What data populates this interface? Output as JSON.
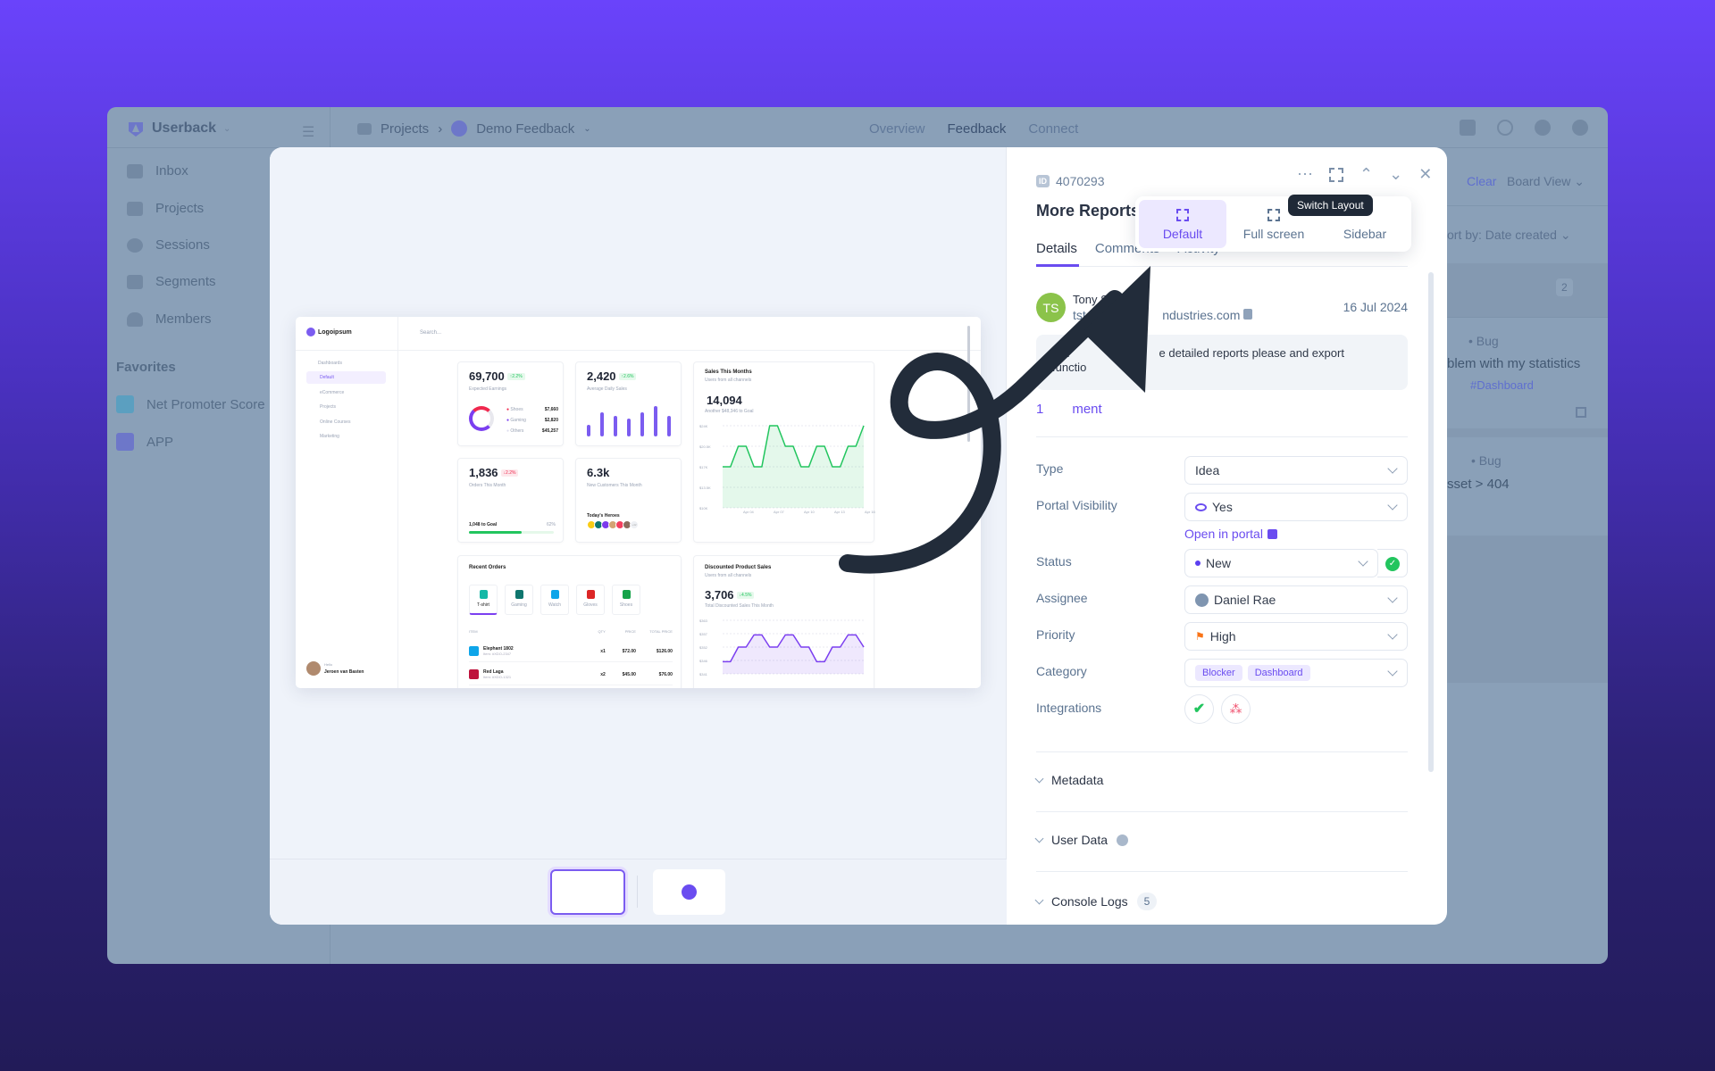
{
  "app": {
    "name": "Userback",
    "breadcrumb": [
      "Projects",
      "Demo Feedback"
    ],
    "nav": [
      "Overview",
      "Feedback",
      "Connect"
    ],
    "sidebar": {
      "items": [
        {
          "label": "Inbox",
          "icon": "inbox-icon"
        },
        {
          "label": "Projects",
          "icon": "folder-icon"
        },
        {
          "label": "Sessions",
          "icon": "play-icon"
        },
        {
          "label": "Segments",
          "icon": "layers-icon"
        },
        {
          "label": "Members",
          "icon": "user-icon"
        }
      ],
      "favorites_title": "Favorites",
      "favorites": [
        {
          "label": "Net Promoter Score",
          "icon": "pie-chart-icon"
        },
        {
          "label": "APP",
          "icon": "userback-logo-icon"
        }
      ]
    },
    "board": {
      "clear": "Clear",
      "view": "Board View",
      "sort": "ort by: Date created",
      "count": "2",
      "cards": [
        {
          "type": "Bug",
          "title": "blem with my statistics",
          "tag": "#Dashboard"
        },
        {
          "type": "Bug",
          "title": "sset > 404"
        }
      ]
    }
  },
  "feedback": {
    "id_badge": "ID",
    "id": "4070293",
    "title": "More Reports",
    "tabs": [
      "Details",
      "Comments",
      "Activity"
    ],
    "layout_menu": {
      "tooltip": "Switch Layout",
      "options": [
        "Default",
        "Full screen",
        "Sidebar"
      ],
      "selected": "Default"
    },
    "user": {
      "initials": "TS",
      "name": "Tony St",
      "email": "tstark",
      "email_rest": "ndustries.com",
      "date": "16 Jul 2024",
      "avatar_color": "#8bc34a"
    },
    "comment": "id li",
    "comment_rest": "e detailed reports please and export",
    "comment_line2": "functio",
    "comments_link": "1",
    "comments_link_rest": "ment",
    "fields": {
      "type": {
        "label": "Type",
        "value": "Idea"
      },
      "portal": {
        "label": "Portal Visibility",
        "value": "Yes",
        "link": "Open in portal"
      },
      "status": {
        "label": "Status",
        "value": "New"
      },
      "assignee": {
        "label": "Assignee",
        "value": "Daniel Rae"
      },
      "priority": {
        "label": "Priority",
        "value": "High"
      },
      "category": {
        "label": "Category",
        "values": [
          "Blocker",
          "Dashboard"
        ]
      },
      "integrations": {
        "label": "Integrations"
      }
    },
    "sections": [
      {
        "label": "Metadata"
      },
      {
        "label": "User Data"
      },
      {
        "label": "Console Logs",
        "count": "5"
      }
    ]
  },
  "preview": {
    "logo": "Logoipsum",
    "search": "Search...",
    "nav_title": "Dashboards",
    "nav": [
      "Default",
      "eCommerce",
      "Projects",
      "Online Courses",
      "Marketing"
    ],
    "user_hello": "Hello",
    "user_name": "Jeroen van Basten",
    "earnings": {
      "value": "69,700",
      "delta": "↑2.2%",
      "label": "Expected Earnings",
      "rows": [
        [
          "Shoes",
          "$7,660"
        ],
        [
          "Gaming",
          "$2,820"
        ],
        [
          "Others",
          "$45,257"
        ]
      ]
    },
    "daily": {
      "value": "2,420",
      "delta": "↑2.6%",
      "label": "Average Daily Sales",
      "bars": [
        0.35,
        0.75,
        0.65,
        0.55,
        0.75,
        0.95,
        0.65
      ]
    },
    "orders": {
      "value": "1,836",
      "delta": "↓2.2%",
      "label": "Orders This Month",
      "goal": "1,048 to Goal",
      "pct": "62%",
      "progress": 0.62
    },
    "customers": {
      "value": "6.3k",
      "label": "New Customers This Month",
      "heroes": "Today's Heroes",
      "more": "+42"
    },
    "sales": {
      "title": "Sales This Months",
      "sub": "Users from all channels",
      "value": "14,094",
      "note": "Another $48,346 to Goal",
      "yticks": [
        "$24K",
        "$20.5K",
        "$17K",
        "$13.5K",
        "$10K"
      ],
      "xticks": [
        "Apr 04",
        "Apr 07",
        "Apr 10",
        "Apr 13",
        "Apr 16"
      ],
      "values": [
        17,
        17,
        20.5,
        20.5,
        17,
        17,
        24,
        24,
        20.5,
        20.5,
        17,
        17,
        20.5,
        20.5,
        17,
        17,
        20.5,
        20.5,
        24
      ],
      "range": [
        10,
        24
      ]
    },
    "recent": {
      "title": "Recent Orders",
      "tabs": [
        "T-shirt",
        "Gaming",
        "Watch",
        "Gloves",
        "Shoes"
      ],
      "cols": [
        "ITEM",
        "QTY",
        "PRICE",
        "TOTAL PRICE"
      ],
      "rows": [
        [
          "Elephant 1802",
          "Item: #XDO-2347",
          "x1",
          "$72.00",
          "$126.00"
        ],
        [
          "Red Laga",
          "Item: #XDO-1321",
          "x2",
          "$45.00",
          "$76.00"
        ]
      ]
    },
    "discount": {
      "title": "Discounted Product Sales",
      "sub": "Users from all channels",
      "value": "3,706",
      "delta": "↓4.5%",
      "label": "Total Discounted Sales This Month",
      "yticks": [
        "$363",
        "$357",
        "$352",
        "$346",
        "$341"
      ],
      "values": [
        346,
        346,
        352,
        352,
        357,
        357,
        352,
        352,
        357,
        357,
        352,
        352,
        346,
        346,
        352,
        352,
        357,
        357,
        352
      ],
      "range": [
        341,
        363
      ]
    }
  },
  "colors": {
    "accent": "#6a4cf0",
    "green": "#22c55e",
    "overlay": "#8aa0b8"
  }
}
